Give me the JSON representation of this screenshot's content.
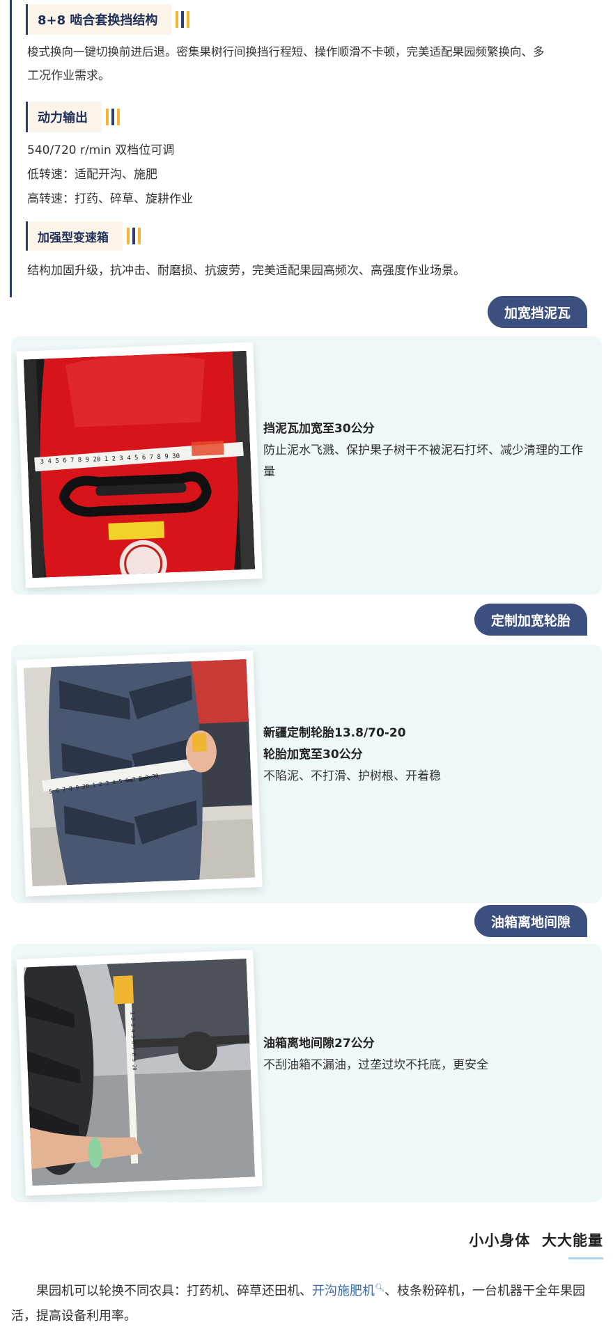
{
  "specs": [
    {
      "heading": "8+8 啮合套换挡结构",
      "lines": [
        "梭式换向一键切换前进后退。密集果树行间换挡行程短、操作顺滑不卡顿，完美适配果园频繁换向、多",
        "工况作业需求。"
      ]
    },
    {
      "heading": "动力输出",
      "lines": [
        "540/720 r/min 双档位可调",
        "低转速：适配开沟、施肥",
        "高转速：打药、碎草、旋耕作业"
      ]
    },
    {
      "heading": "加强型变速箱",
      "lines": [
        "结构加固升级，抗冲击、耐磨损、抗疲劳，完美适配果园高频次、高强度作业场景。"
      ]
    }
  ],
  "features": [
    {
      "tag": "加宽挡泥瓦",
      "title_lines": [
        "挡泥瓦加宽至30公分"
      ],
      "desc": "防止泥水飞溅、保护果子树干不被泥石打坏、减少清理的工作量",
      "tape_text": "3 4 5 6 7 8 9 20 1 2 3 4 5 6 7 8 9 30"
    },
    {
      "tag": "定制加宽轮胎",
      "title_lines": [
        "新疆定制轮胎13.8/70-20",
        "轮胎加宽至30公分"
      ],
      "desc": "不陷泥、不打滑、护树根、开着稳",
      "tape_text": "5 6 7 8 9 20 1 2 3 4 5 6 7 8 9 30"
    },
    {
      "tag": "油箱离地间隙",
      "title_lines": [
        "油箱离地间隙27公分"
      ],
      "desc": "不刮油箱不漏油，过垄过坎不托底，更安全",
      "tape_text": "1 2 3 4 5 6 7 8 9 20"
    }
  ],
  "section": {
    "title": "小小身体  大大能量"
  },
  "bottom": {
    "before": "果园机可以轮换不同农具：打药机、碎草还田机、",
    "link": "开沟施肥机",
    "after": "、枝条粉碎机，一台机器干全年果园活，提高设备利用率。"
  },
  "colors": {
    "navy": "#2e3f6b",
    "pill": "#3c5080",
    "card_bg": "#eef8f8",
    "tag_bg": "#fbf4e8",
    "accent_yellow": "#f2b534",
    "link": "#3c6ea6"
  }
}
